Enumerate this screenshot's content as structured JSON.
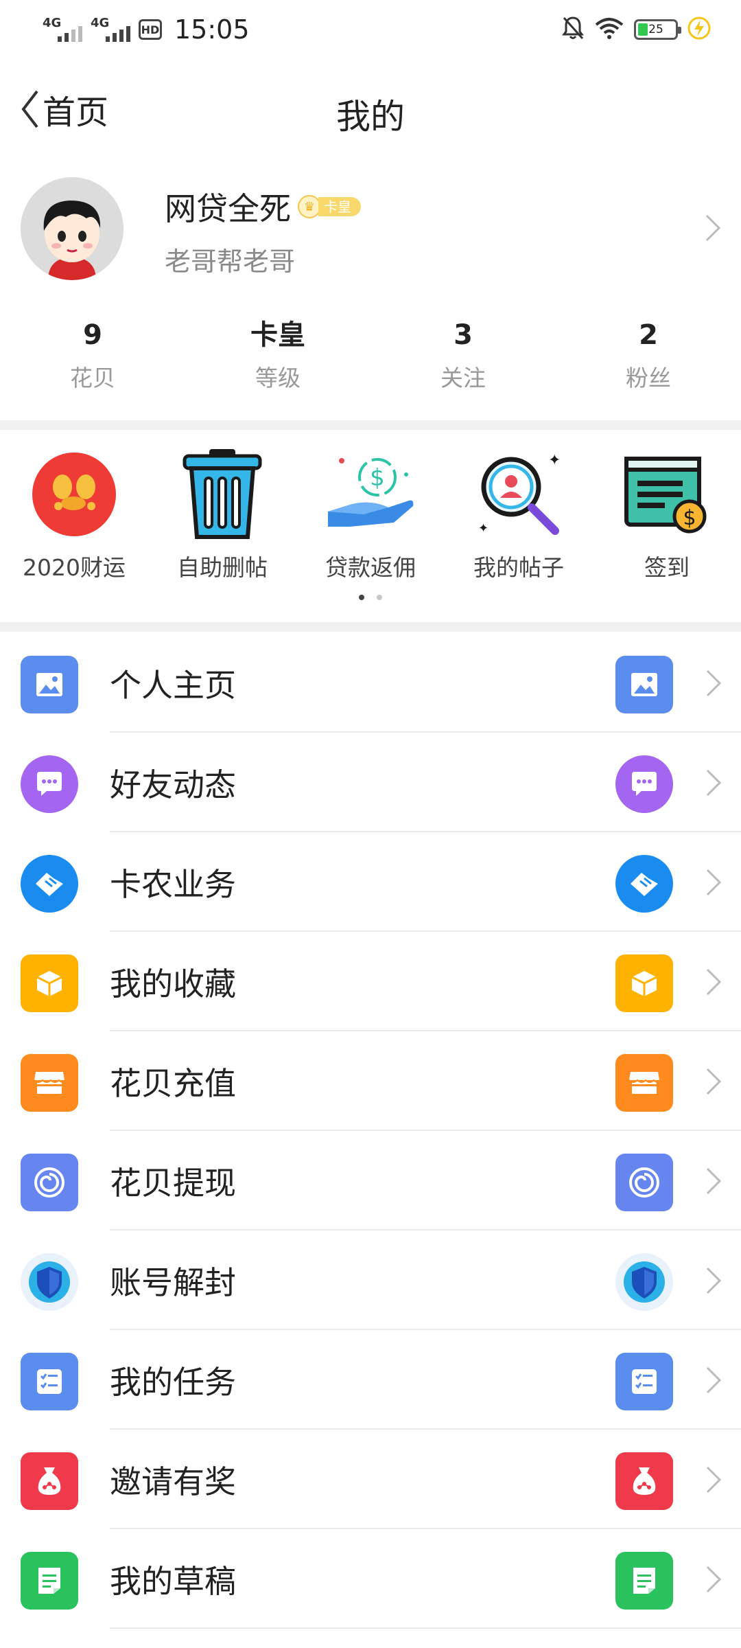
{
  "status_bar": {
    "signal1": "4G",
    "signal2": "4G",
    "hd": "HD",
    "time": "15:05",
    "battery": "25"
  },
  "nav": {
    "back_label": "首页",
    "title": "我的"
  },
  "profile": {
    "username": "网贷全死",
    "badge": "卡皇",
    "signature": "老哥帮老哥"
  },
  "stats": [
    {
      "value": "9",
      "label": "花贝"
    },
    {
      "value": "卡皇",
      "label": "等级"
    },
    {
      "value": "3",
      "label": "关注"
    },
    {
      "value": "2",
      "label": "粉丝"
    }
  ],
  "quick_items": [
    {
      "label": "2020财运",
      "icon": "lucky-envelope-icon"
    },
    {
      "label": "自助删帖",
      "icon": "trash-can-icon"
    },
    {
      "label": "贷款返佣",
      "icon": "hand-money-icon"
    },
    {
      "label": "我的帖子",
      "icon": "search-user-icon"
    },
    {
      "label": "签到",
      "icon": "checkin-screen-icon"
    }
  ],
  "pager": {
    "pages": 2,
    "active": 0
  },
  "menu": [
    {
      "label": "个人主页",
      "icon": "picture-icon",
      "color": "#5b8def"
    },
    {
      "label": "好友动态",
      "icon": "chat-bubble-icon",
      "color": "#a465f0"
    },
    {
      "label": "卡农业务",
      "icon": "handshake-icon",
      "color": "#1a8cf0"
    },
    {
      "label": "我的收藏",
      "icon": "box-icon",
      "color": "#ffb300"
    },
    {
      "label": "花贝充值",
      "icon": "store-icon",
      "color": "#ff8a1e"
    },
    {
      "label": "花贝提现",
      "icon": "spiral-icon",
      "color": "#6685ee"
    },
    {
      "label": "账号解封",
      "icon": "shield-icon",
      "color": "#2a6fd6"
    },
    {
      "label": "我的任务",
      "icon": "task-list-icon",
      "color": "#5b8def"
    },
    {
      "label": "邀请有奖",
      "icon": "money-bag-icon",
      "color": "#f0394a"
    },
    {
      "label": "我的草稿",
      "icon": "draft-icon",
      "color": "#29c25c"
    }
  ]
}
